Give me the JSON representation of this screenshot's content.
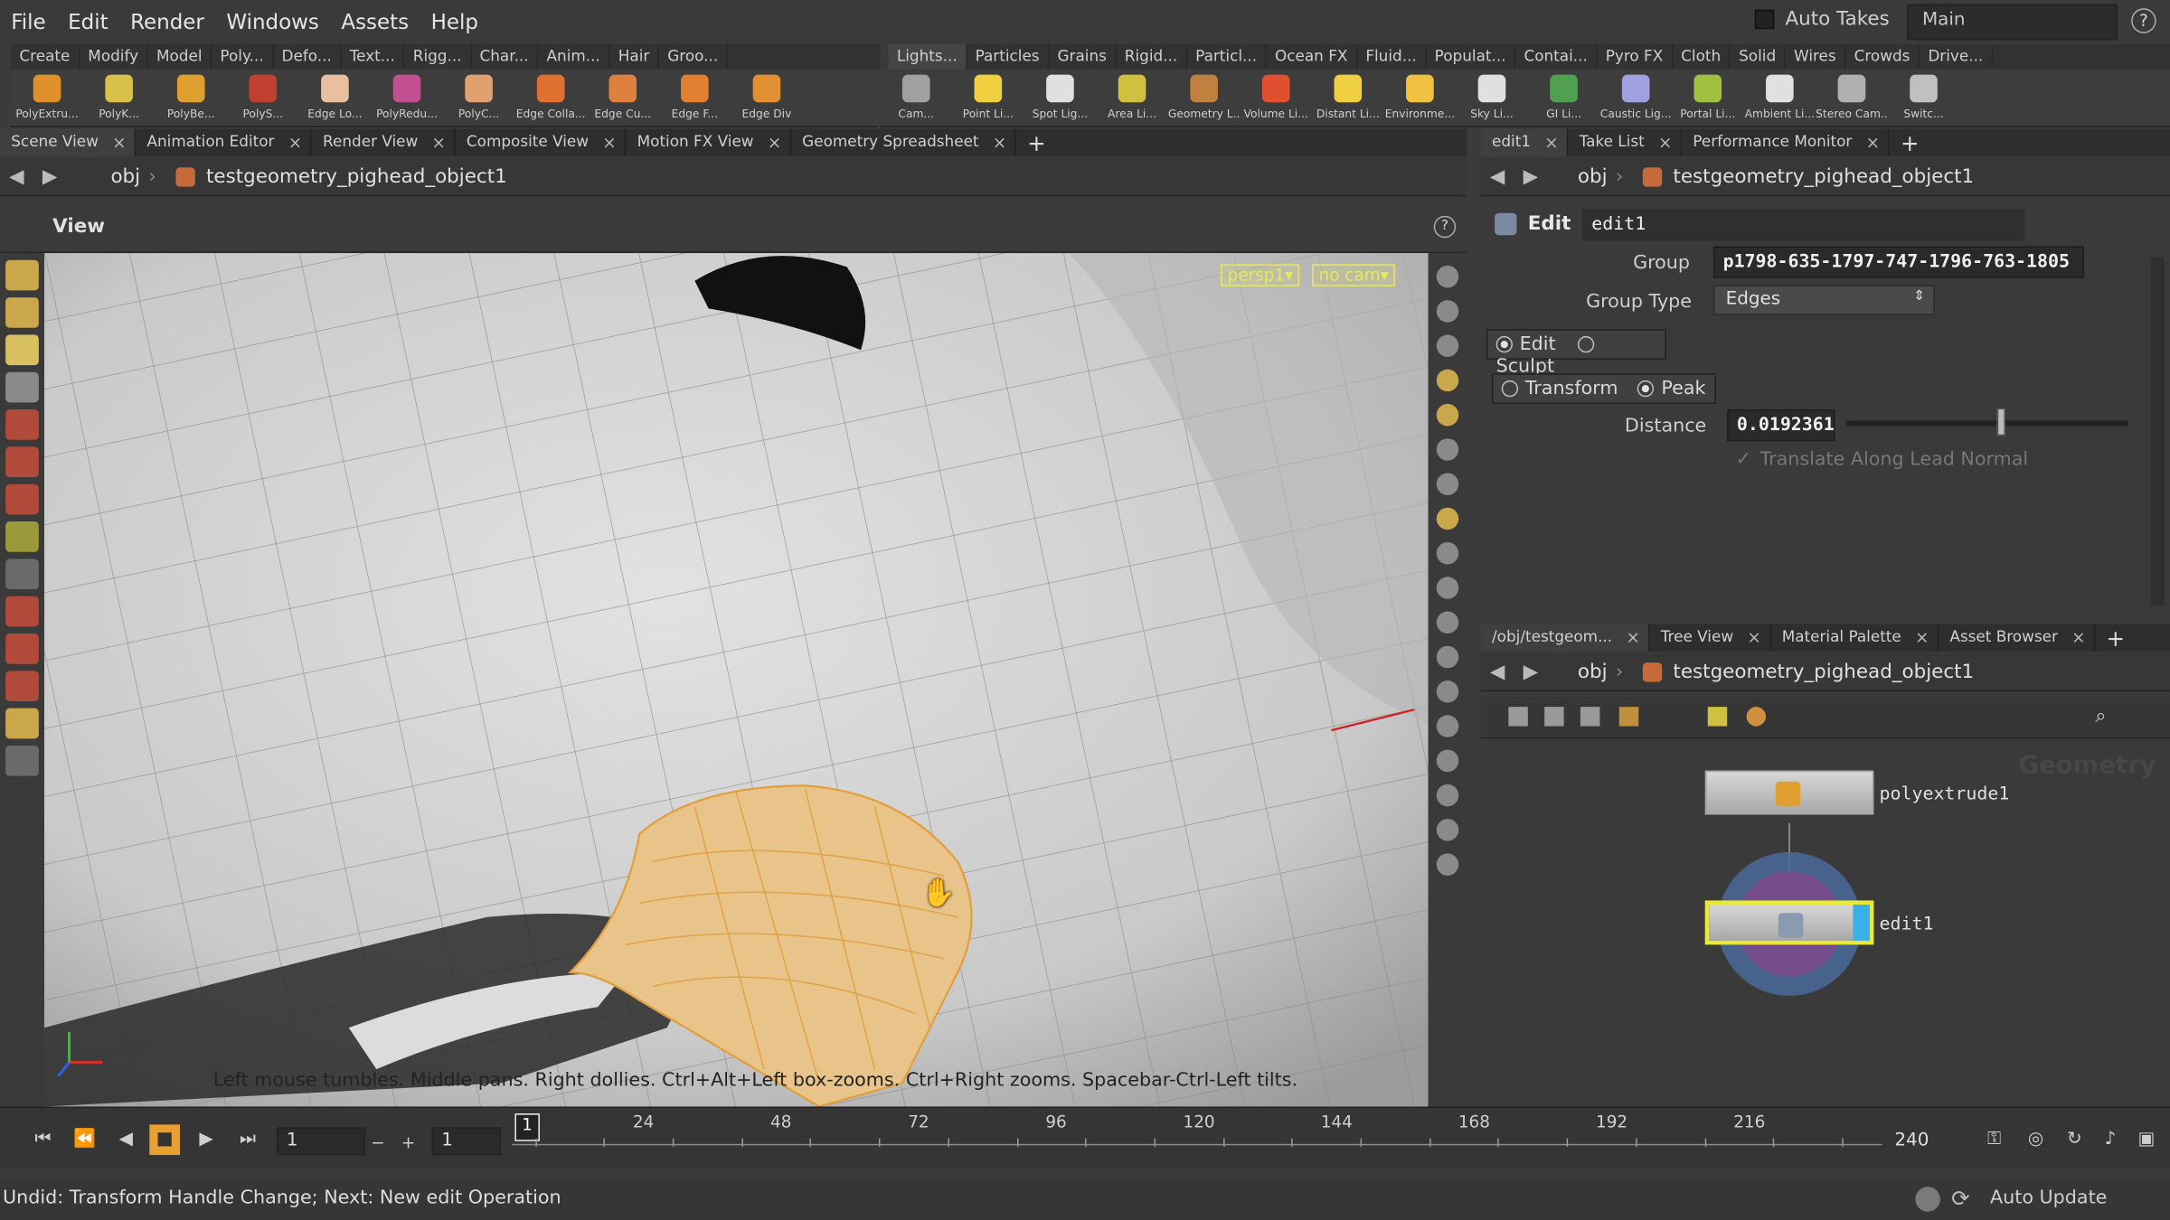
{
  "menu": [
    "File",
    "Edit",
    "Render",
    "Windows",
    "Assets",
    "Help"
  ],
  "auto_takes": "Auto Takes",
  "desktop": "Main",
  "shelf_tabs_left": [
    "Create",
    "Modify",
    "Model",
    "Poly...",
    "Defo...",
    "Text...",
    "Rigg...",
    "Char...",
    "Anim...",
    "Hair",
    "Groo..."
  ],
  "shelf_tabs_right": [
    "Lights...",
    "Particles",
    "Grains",
    "Rigid...",
    "Particl...",
    "Ocean FX",
    "Fluid...",
    "Populat...",
    "Contai...",
    "Pyro FX",
    "Cloth",
    "Solid",
    "Wires",
    "Crowds",
    "Drive..."
  ],
  "tools_left": [
    {
      "label": "PolyExtru...",
      "color": "#e0902a"
    },
    {
      "label": "PolyK...",
      "color": "#d8c04a"
    },
    {
      "label": "PolyBe...",
      "color": "#e0a030"
    },
    {
      "label": "PolyS...",
      "color": "#c04030"
    },
    {
      "label": "Edge Lo...",
      "color": "#e8c0a0"
    },
    {
      "label": "PolyRedu...",
      "color": "#c05090"
    },
    {
      "label": "PolyC...",
      "color": "#e0a070"
    },
    {
      "label": "Edge Colla...",
      "color": "#e07030"
    },
    {
      "label": "Edge Cu...",
      "color": "#e08040"
    },
    {
      "label": "Edge F...",
      "color": "#e08030"
    },
    {
      "label": "Edge Div",
      "color": "#e09030"
    }
  ],
  "tools_right": [
    {
      "label": "Cam...",
      "color": "#a0a0a0"
    },
    {
      "label": "Point Li...",
      "color": "#f0d040"
    },
    {
      "label": "Spot Lig...",
      "color": "#e0e0e0"
    },
    {
      "label": "Area Li...",
      "color": "#d0c040"
    },
    {
      "label": "Geometry L...",
      "color": "#c08040"
    },
    {
      "label": "Volume Li...",
      "color": "#e05030"
    },
    {
      "label": "Distant Li...",
      "color": "#f0d040"
    },
    {
      "label": "Environme...",
      "color": "#f0c040"
    },
    {
      "label": "Sky Li...",
      "color": "#e0e0e0"
    },
    {
      "label": "GI Li...",
      "color": "#50a050"
    },
    {
      "label": "Caustic Lig...",
      "color": "#a0a0e0"
    },
    {
      "label": "Portal Li...",
      "color": "#a0c040"
    },
    {
      "label": "Ambient Li...",
      "color": "#e0e0e0"
    },
    {
      "label": "Stereo Cam...",
      "color": "#b0b0b0"
    },
    {
      "label": "Switc...",
      "color": "#c0c0c0"
    }
  ],
  "left_tabs": [
    "Scene View",
    "Animation Editor",
    "Render View",
    "Composite View",
    "Motion FX View",
    "Geometry Spreadsheet"
  ],
  "path": {
    "root": "obj",
    "node": "testgeometry_pighead_object1"
  },
  "view_title": "View",
  "viewport_tags": {
    "persp": "persp1▾",
    "cam": "no cam▾"
  },
  "viewport_hint": "Left mouse tumbles. Middle pans. Right dollies. Ctrl+Alt+Left box-zooms. Ctrl+Right zooms. Spacebar-Ctrl-Left tilts.",
  "right_top_tabs": [
    "edit1",
    "Take List",
    "Performance Monitor"
  ],
  "params": {
    "op_label": "Edit",
    "node_name": "edit1",
    "group_label": "Group",
    "group_value": "p1798-635-1797-747-1796-763-1805",
    "group_type_label": "Group Type",
    "group_type_value": "Edges",
    "mode_edit": "Edit",
    "mode_sculpt": "Sculpt",
    "transform": "Transform",
    "peak": "Peak",
    "distance_label": "Distance",
    "distance_value": "0.0192361",
    "distance_fraction": 0.55,
    "translate_label": "Translate Along Lead Normal"
  },
  "right_bottom_tabs": [
    "/obj/testgeom...",
    "Tree View",
    "Material Palette",
    "Asset Browser"
  ],
  "network_watermark": "Geometry",
  "nodes": [
    {
      "name": "polyextrude1"
    },
    {
      "name": "edit1"
    }
  ],
  "timeline": {
    "current_frame": "1",
    "start": "1",
    "step": "1",
    "end": "240",
    "marker": "1",
    "ticks": [
      "24",
      "48",
      "72",
      "96",
      "120",
      "144",
      "168",
      "192",
      "216"
    ]
  },
  "status": "Undid: Transform Handle Change; Next: New edit Operation",
  "auto_update": "Auto Update"
}
